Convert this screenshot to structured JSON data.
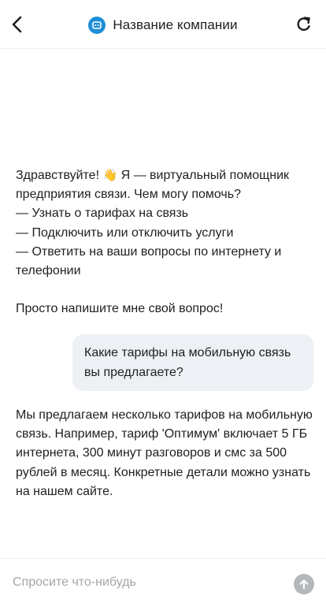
{
  "header": {
    "title": "Название компании",
    "back_icon": "chevron-left-icon",
    "logo_icon": "bot-logo-icon",
    "refresh_icon": "refresh-icon",
    "logo_color": "#1e8fd6"
  },
  "messages": [
    {
      "role": "bot",
      "greeting_before_emoji": "Здравствуйте! ",
      "emoji": "👋",
      "greeting_after_emoji": " Я — виртуальный помощник предприятия связи. Чем могу помочь?",
      "options": [
        "— Узнать о тарифах на связь",
        "— Подключить или отключить услуги",
        "— Ответить на ваши вопросы по интернету и телефонии"
      ],
      "closing": "Просто напишите мне свой вопрос!"
    },
    {
      "role": "user",
      "text": "Какие тарифы на мобильную связь вы предлагаете?"
    },
    {
      "role": "bot",
      "text": "Мы предлагаем несколько тарифов на мобильную связь. Например, тариф 'Оптимум' включает 5 ГБ интернета, 300 минут разговоров и смс за 500 рублей в месяц. Конкретные детали можно узнать на нашем сайте."
    }
  ],
  "composer": {
    "placeholder": "Спросите что-нибудь",
    "value": "",
    "send_icon": "arrow-up-icon"
  },
  "colors": {
    "user_bubble": "#edf0f4",
    "send_button_disabled": "#b4b7bc",
    "text": "#1f1f1f",
    "placeholder": "#a3a6ab"
  }
}
